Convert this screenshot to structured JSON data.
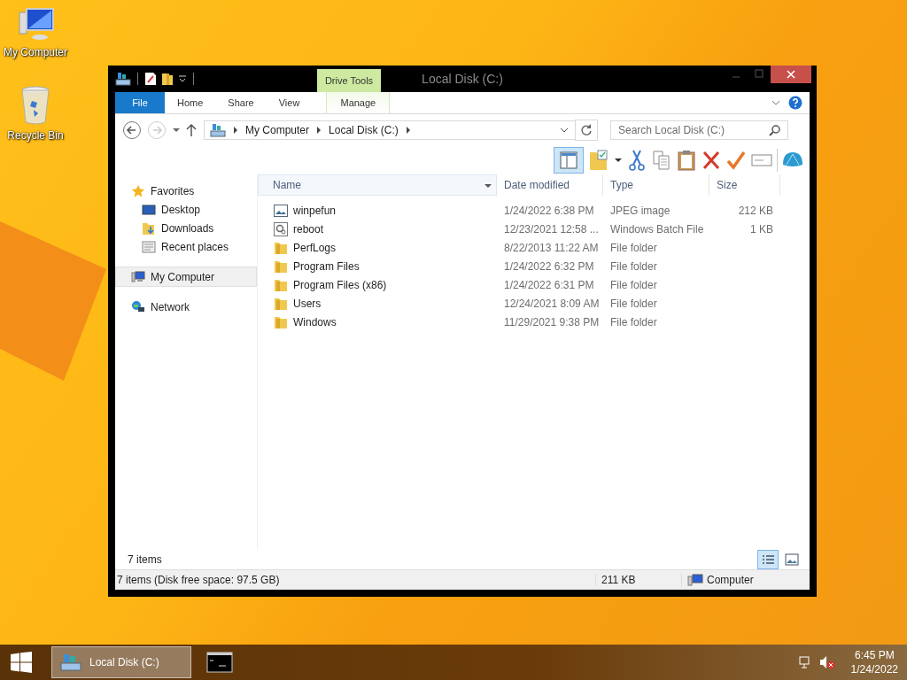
{
  "desktop_icons": [
    {
      "kind": "computer",
      "label": "My Computer"
    },
    {
      "kind": "bin",
      "label": "Recycle Bin"
    }
  ],
  "window": {
    "title": "Local Disk (C:)",
    "contextual_tab": "Drive Tools"
  },
  "ribbon_tabs": [
    {
      "kind": "file",
      "label": "File",
      "selected": false
    },
    {
      "kind": "tab",
      "label": "Home",
      "selected": false
    },
    {
      "kind": "tab",
      "label": "Share",
      "selected": false
    },
    {
      "kind": "tab",
      "label": "View",
      "selected": false
    },
    {
      "kind": "context",
      "label": "Manage",
      "selected": false
    }
  ],
  "address": {
    "path": [
      "My Computer",
      "Local Disk (C:)"
    ]
  },
  "search": {
    "placeholder": "Search Local Disk (C:)"
  },
  "toolbar": {
    "preview_pane_on": true
  },
  "navigation": [
    {
      "kind": "star",
      "label": "Favorites",
      "selected": false,
      "children": [
        {
          "kind": "desktop",
          "label": "Desktop",
          "selected": false
        },
        {
          "kind": "downloads",
          "label": "Downloads",
          "selected": false
        },
        {
          "kind": "recent",
          "label": "Recent places",
          "selected": false
        }
      ]
    },
    {
      "kind": "computer",
      "label": "My Computer",
      "selected": true
    },
    {
      "kind": "network",
      "label": "Network",
      "selected": false
    }
  ],
  "table": {
    "columns": [
      "Name",
      "Date modified",
      "Type",
      "Size"
    ],
    "rows": [
      {
        "kind": "image",
        "name": "winpefun",
        "date": "1/24/2022 6:38 PM",
        "type": "JPEG image",
        "size": "212 KB"
      },
      {
        "kind": "batch",
        "name": "reboot",
        "date": "12/23/2021 12:58 ...",
        "type": "Windows Batch File",
        "size": "1 KB"
      },
      {
        "kind": "folder",
        "name": "PerfLogs",
        "date": "8/22/2013 11:22 AM",
        "type": "File folder"
      },
      {
        "kind": "folder",
        "name": "Program Files",
        "date": "1/24/2022 6:32 PM",
        "type": "File folder"
      },
      {
        "kind": "folder",
        "name": "Program Files (x86)",
        "date": "1/24/2022 6:31 PM",
        "type": "File folder"
      },
      {
        "kind": "folder",
        "name": "Users",
        "date": "12/24/2021 8:09 AM",
        "type": "File folder"
      },
      {
        "kind": "folder",
        "name": "Windows",
        "date": "11/29/2021 9:38 PM",
        "type": "File folder"
      }
    ]
  },
  "item_count": "7 items",
  "views": [
    {
      "kind": "details",
      "selected": true
    },
    {
      "kind": "large",
      "selected": false
    }
  ],
  "status_bar": {
    "summary": "7 items (Disk free space: 97.5 GB)",
    "size": "211 KB",
    "location": "Computer"
  },
  "taskbar": {
    "buttons": [
      {
        "kind": "disk",
        "label": "Local Disk (C:)",
        "selected": true
      },
      {
        "kind": "console",
        "selected": false
      }
    ],
    "time": "6:45 PM",
    "date": "1/24/2022"
  }
}
